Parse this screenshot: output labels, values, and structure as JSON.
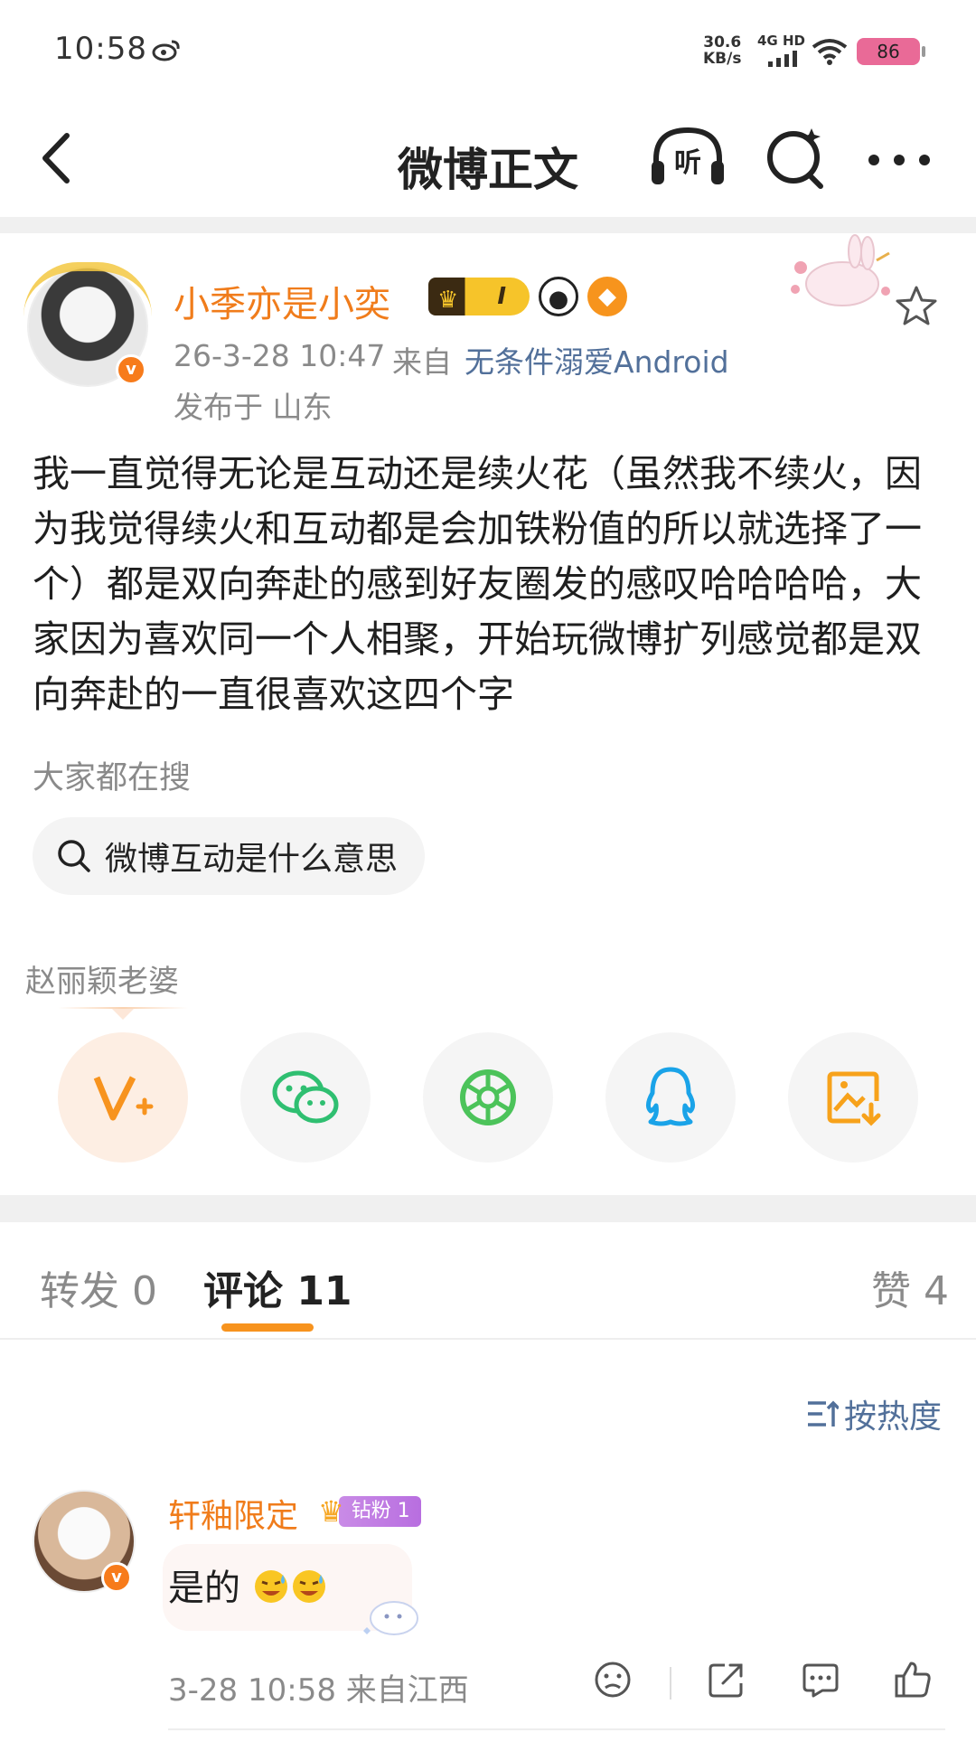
{
  "status_bar": {
    "time": "10:58",
    "net_speed_value": "30.6",
    "net_speed_unit": "KB/s",
    "network": "4G HD",
    "battery": "86"
  },
  "nav": {
    "title": "微博正文",
    "listen_label": "听"
  },
  "post": {
    "username": "小季亦是小奕",
    "level_badge": "I",
    "timestamp": "26-3-28 10:47",
    "from_label": "来自",
    "client": "无条件溺爱Android",
    "location": "发布于 山东",
    "text": "我一直觉得无论是互动还是续火花（虽然我不续火，因为我觉得续火和互动都是会加铁粉值的所以就选择了一个）都是双向奔赴的感到好友圈发的感叹哈哈哈哈，大家因为喜欢同一个人相聚，开始玩微博扩列感觉都是双向奔赴的一直很喜欢这四个字"
  },
  "hot_search": {
    "label": "大家都在搜",
    "query": "微博互动是什么意思"
  },
  "share": {
    "target_name": "赵丽颖老婆",
    "buttons": [
      {
        "icon": "weibo-v-plus-icon",
        "color": "#f7931e"
      },
      {
        "icon": "wechat-icon",
        "color": "#2fbf71"
      },
      {
        "icon": "moments-icon",
        "color": "#4cc35a"
      },
      {
        "icon": "qq-icon",
        "color": "#1aa3e8"
      },
      {
        "icon": "save-image-icon",
        "color": "#f7a21b"
      }
    ]
  },
  "tabs": {
    "repost": "转发 0",
    "comments": "评论 11",
    "likes": "赞 4"
  },
  "sort": {
    "label": "按热度"
  },
  "comments": [
    {
      "username": "轩釉限定",
      "fan_badge": "钻粉 1",
      "text": "是的",
      "meta": "3-28 10:58  来自江西"
    }
  ],
  "colors": {
    "accent": "#f7931e",
    "username": "#f07c1b",
    "link": "#52709a",
    "battery": "#e96a97"
  }
}
